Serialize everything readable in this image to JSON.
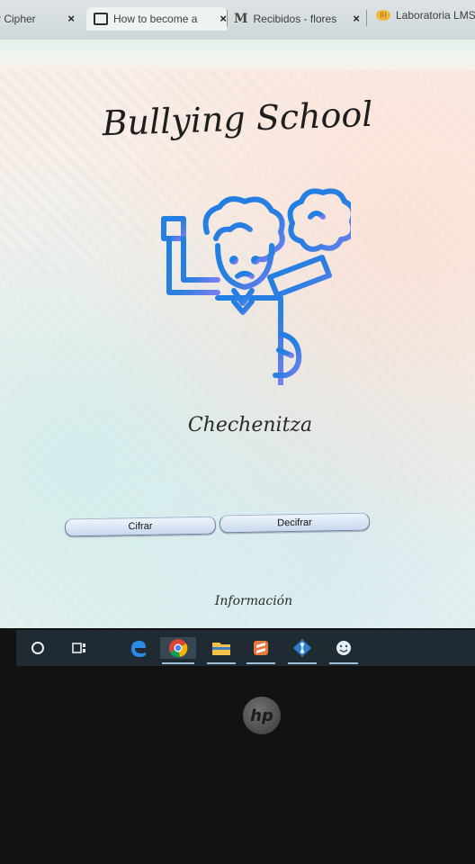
{
  "tabs": [
    {
      "label": "r Cipher",
      "icon": "close-icon"
    },
    {
      "label": "How to become a",
      "icon": "page-icon"
    },
    {
      "label": "Recibidos - flores",
      "icon": "gmail-icon"
    },
    {
      "label": "Laboratoria LMS",
      "icon": "laboratoria-icon"
    }
  ],
  "tab_close": "×",
  "page": {
    "title": "Bullying School",
    "author": "Chechenitza",
    "buttons": {
      "encrypt": "Cifrar",
      "decrypt": "Decifrar"
    },
    "info_link": "Información",
    "accent_color": "#1f7fe3",
    "hero_icon": "bullied-student-icon"
  },
  "taskbar": {
    "items": [
      "start-icon",
      "task-view-icon",
      "edge-icon",
      "chrome-icon",
      "file-explorer-icon",
      "sublime-text-icon",
      "git-icon",
      "emoji-app-icon"
    ]
  },
  "device": {
    "logo": "hp"
  }
}
